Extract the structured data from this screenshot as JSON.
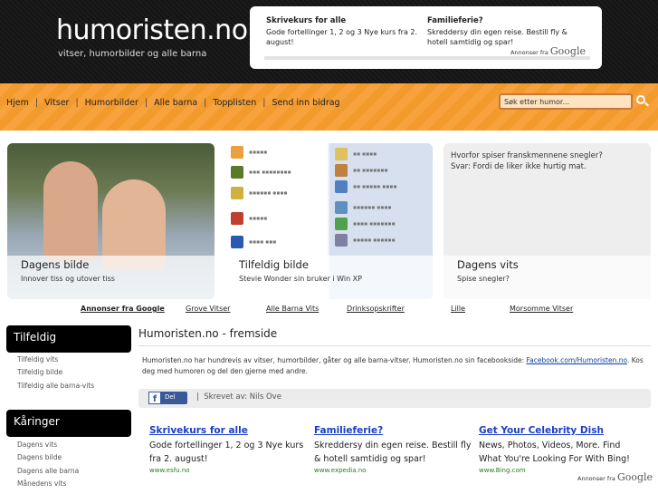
{
  "header": {
    "logo": "humoristen.no",
    "tagline": "vitser, humorbilder og alle barna",
    "ads": [
      {
        "title": "Skrivekurs for alle",
        "text": "Gode fortellinger 1, 2 og 3 Nye kurs fra 2. august!"
      },
      {
        "title": "Familieferie?",
        "text": "Skreddersy din egen reise. Bestill fly & hotell samtidig og spar!"
      }
    ],
    "ads_by_prefix": "Annonser fra",
    "ads_by_brand": "Google"
  },
  "nav": {
    "items": [
      "Hjem",
      "Vitser",
      "Humorbilder",
      "Alle barna",
      "Topplisten",
      "Send inn bidrag"
    ],
    "search_placeholder": "Søk etter humor..."
  },
  "features": [
    {
      "title": "Dagens bilde",
      "subtitle": "Innover tiss og utover tiss"
    },
    {
      "title": "Tilfeldig bilde",
      "subtitle": "Stevie Wonder sin bruker i Win XP"
    },
    {
      "title": "Dagens vits",
      "subtitle": "Spise snegler?",
      "joke_q": "Hvorfor spiser franskmennene snegler?",
      "joke_a": "Svar: Fordi de liker ikke hurtig mat."
    }
  ],
  "adlinks": {
    "label": "Annonser fra Google",
    "links": [
      "Grove Vitser",
      "Alle Barna Vits",
      "Drinksopskrifter",
      "Lille",
      "Morsomme Vitser"
    ]
  },
  "sidebar": {
    "random": {
      "title": "Tilfeldig",
      "links": [
        "Tilfeldig vits",
        "Tilfeldig bilde",
        "Tilfeldig alle barna-vits"
      ]
    },
    "awards": {
      "title": "Kåringer",
      "links": [
        "Dagens vits",
        "Dagens bilde",
        "Dagens alle barna",
        "Månedens vits"
      ]
    }
  },
  "main": {
    "title": "Humoristen.no - fremside",
    "intro_text": "Humoristen.no har hundrevis av vitser, humorbilder, gåter og alle barna-vitser. Humoristen.no sin facebookside:",
    "intro_link": "Facebook.com/Humoristen.no",
    "intro_tail": ". Kos deg med humoren og del den gjerne med andre.",
    "share_label": "Del",
    "author_sep": "|",
    "author": "Skrevet av: Nils Ove"
  },
  "bottom_ads": [
    {
      "title": "Skrivekurs for alle",
      "body": "Gode fortellinger 1, 2 og 3 Nye kurs fra 2. august!",
      "url": "www.esfu.no"
    },
    {
      "title": "Familieferie?",
      "body": "Skreddersy din egen reise. Bestill fly & hotell samtidig og spar!",
      "url": "www.expedia.no"
    },
    {
      "title": "Get Your Celebrity Dish",
      "body": "News, Photos, Videos, More. Find What You're Looking For With Bing!",
      "url": "www.Bing.com"
    }
  ],
  "colors": {
    "nav_orange": "#f7a23c",
    "header_dark": "#1a1a1a",
    "link_blue": "#1a3fc7"
  }
}
